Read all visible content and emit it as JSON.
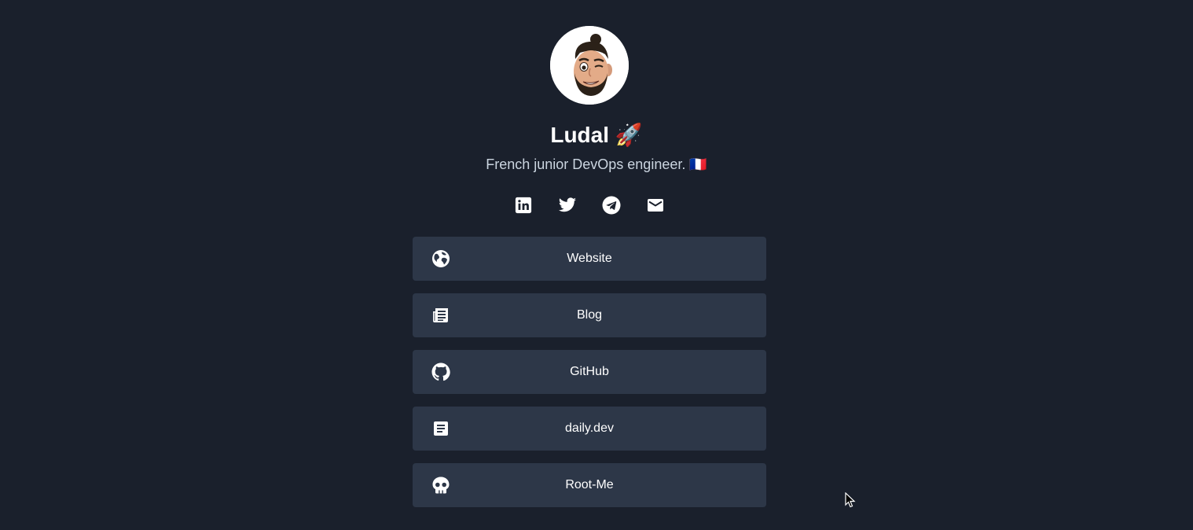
{
  "profile": {
    "name": "Ludal 🚀",
    "bio": "French junior DevOps engineer. 🇫🇷"
  },
  "socials": [
    {
      "icon": "linkedin-icon"
    },
    {
      "icon": "twitter-icon"
    },
    {
      "icon": "telegram-icon"
    },
    {
      "icon": "email-icon"
    }
  ],
  "links": [
    {
      "label": "Website",
      "icon": "globe-icon"
    },
    {
      "label": "Blog",
      "icon": "newspaper-icon"
    },
    {
      "label": "GitHub",
      "icon": "github-icon"
    },
    {
      "label": "daily.dev",
      "icon": "article-icon"
    },
    {
      "label": "Root-Me",
      "icon": "skull-icon"
    }
  ],
  "colors": {
    "background": "#1a202c",
    "button": "#2d3748",
    "text": "#ffffff",
    "muted": "#cbd5e0"
  }
}
